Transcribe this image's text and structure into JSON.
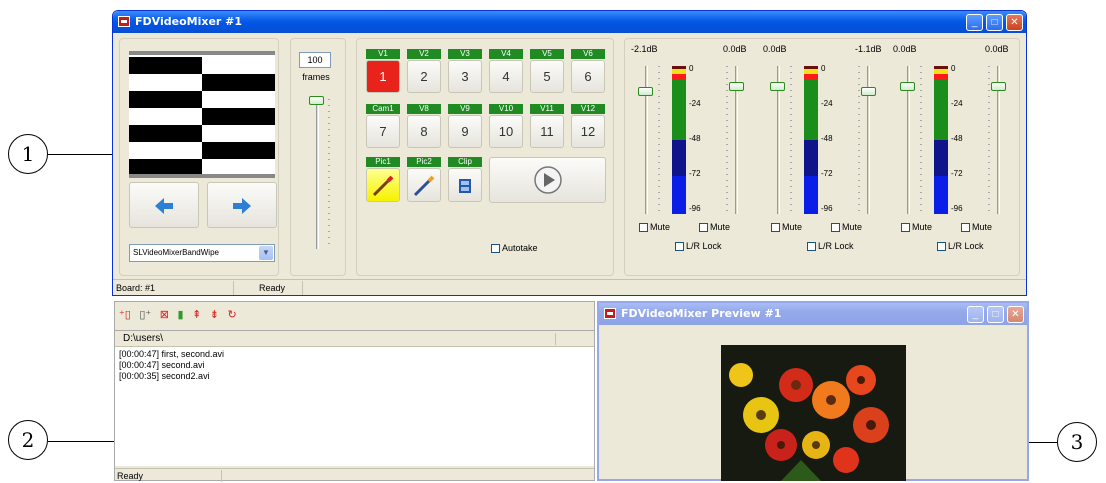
{
  "mixer": {
    "title": "FDVideoMixer #1",
    "frames_value": "100",
    "frames_label": "frames",
    "effect_select": "SLVideoMixerBandWipe",
    "channels_row1": [
      {
        "label": "V1",
        "num": "1"
      },
      {
        "label": "V2",
        "num": "2"
      },
      {
        "label": "V3",
        "num": "3"
      },
      {
        "label": "V4",
        "num": "4"
      },
      {
        "label": "V5",
        "num": "5"
      },
      {
        "label": "V6",
        "num": "6"
      }
    ],
    "channels_row2": [
      {
        "label": "Cam1",
        "num": "7"
      },
      {
        "label": "V8",
        "num": "8"
      },
      {
        "label": "V9",
        "num": "9"
      },
      {
        "label": "V10",
        "num": "10"
      },
      {
        "label": "V11",
        "num": "11"
      },
      {
        "label": "V12",
        "num": "12"
      }
    ],
    "pic1_label": "Pic1",
    "pic2_label": "Pic2",
    "clip_label": "Clip",
    "autotake_label": "Autotake",
    "db_labels": [
      "-2.1dB",
      "0.0dB",
      "0.0dB",
      "-1.1dB",
      "0.0dB",
      "0.0dB"
    ],
    "meter_scale": [
      "0",
      "-24",
      "-48",
      "-72",
      "-96"
    ],
    "mute_label": "Mute",
    "lr_lock_label": "L/R Lock",
    "status_board": "Board: #1",
    "status_ready": "Ready",
    "active_channel_color": "#e8231b"
  },
  "playlist": {
    "path": "D:\\users\\",
    "items": [
      "[00:00:47] first, second.avi",
      "[00:00:47] second.avi",
      "[00:00:35] second2.avi"
    ],
    "status": "Ready"
  },
  "preview": {
    "title": "FDVideoMixer Preview #1"
  },
  "callouts": [
    "1",
    "2",
    "3"
  ]
}
